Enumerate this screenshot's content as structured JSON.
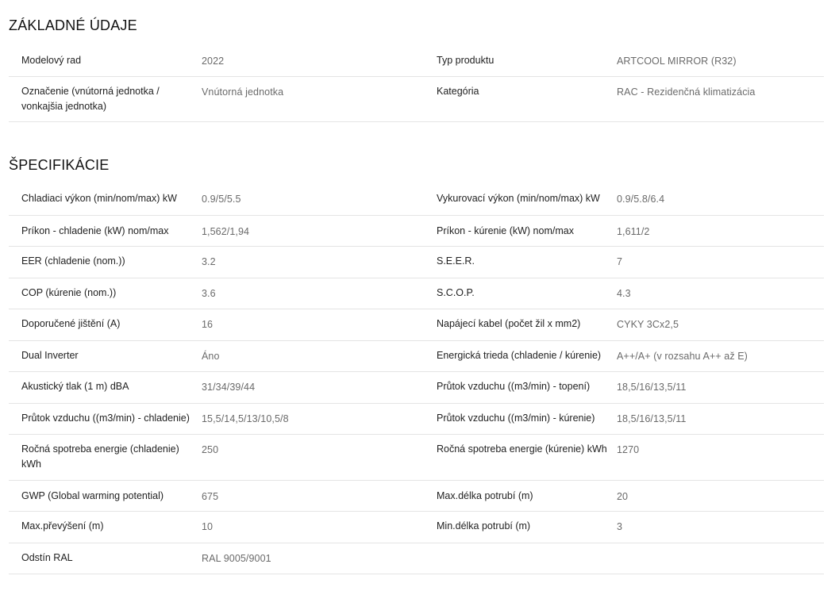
{
  "basic": {
    "title": "ZÁKLADNÉ ÚDAJE",
    "rows": [
      {
        "l1": "Modelový rad",
        "v1": "2022",
        "l2": "Typ produktu",
        "v2": "ARTCOOL MIRROR (R32)"
      },
      {
        "l1": "Označenie (vnútorná jednotka / vonkajšia jednotka)",
        "v1": "Vnútorná jednotka",
        "l2": "Kategória",
        "v2": "RAC - Rezidenčná klimatizácia"
      }
    ]
  },
  "specs": {
    "title": "ŠPECIFIKÁCIE",
    "rows": [
      {
        "l1": "Chladiaci výkon (min/nom/max) kW",
        "v1": "0.9/5/5.5",
        "l2": "Vykurovací výkon (min/nom/max) kW",
        "v2": "0.9/5.8/6.4"
      },
      {
        "l1": "Príkon - chladenie (kW) nom/max",
        "v1": "1,562/1,94",
        "l2": "Príkon - kúrenie (kW) nom/max",
        "v2": "1,611/2"
      },
      {
        "l1": "EER (chladenie (nom.))",
        "v1": "3.2",
        "l2": "S.E.E.R.",
        "v2": "7"
      },
      {
        "l1": "COP (kúrenie (nom.))",
        "v1": "3.6",
        "l2": "S.C.O.P.",
        "v2": "4.3"
      },
      {
        "l1": "Doporučené jištění (A)",
        "v1": "16",
        "l2": "Napájecí kabel (počet žil x mm2)",
        "v2": "CYKY 3Cx2,5"
      },
      {
        "l1": "Dual Inverter",
        "v1": "Áno",
        "l2": "Energická trieda (chladenie / kúrenie)",
        "v2": "A++/A+ (v rozsahu A++ až E)"
      },
      {
        "l1": "Akustický tlak (1 m) dBA",
        "v1": "31/34/39/44",
        "l2": "Průtok vzduchu ((m3/min) - topení)",
        "v2": "18,5/16/13,5/11"
      },
      {
        "l1": "Průtok vzduchu ((m3/min) - chladenie)",
        "v1": "15,5/14,5/13/10,5/8",
        "l2": "Průtok vzduchu ((m3/min) - kúrenie)",
        "v2": "18,5/16/13,5/11"
      },
      {
        "l1": "Ročná spotreba energie (chladenie) kWh",
        "v1": "250",
        "l2": "Ročná spotreba energie (kúrenie) kWh",
        "v2": "1270"
      },
      {
        "l1": "GWP (Global warming potential)",
        "v1": "675",
        "l2": "Max.délka potrubí (m)",
        "v2": "20"
      },
      {
        "l1": "Max.převýšení (m)",
        "v1": "10",
        "l2": "Min.délka potrubí (m)",
        "v2": "3"
      },
      {
        "l1": "Odstín RAL",
        "v1": "RAL 9005/9001",
        "l2": "",
        "v2": ""
      }
    ]
  }
}
